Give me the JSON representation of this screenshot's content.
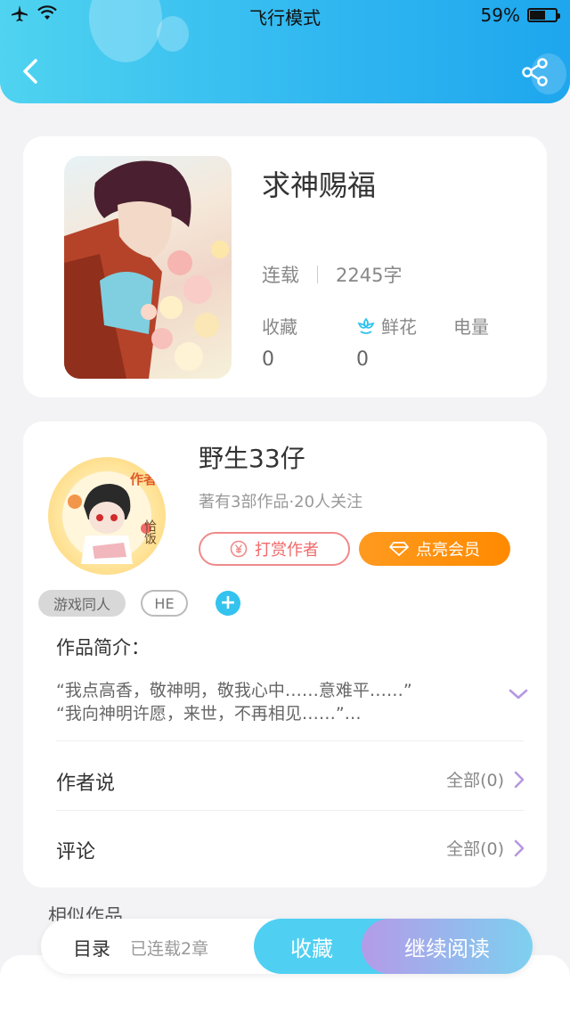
{
  "status_bar": {
    "carrier_mode": "飞行模式",
    "battery_percent": "59%",
    "battery_level": 0.59
  },
  "header": {
    "back_icon": "back-arrow-icon",
    "share_icon": "share-icon"
  },
  "book": {
    "title": "求神赐福",
    "status": "连载",
    "word_count": "2245字",
    "stats": {
      "favorites_label": "收藏",
      "favorites_value": "0",
      "flowers_label": "鲜花",
      "flowers_value": "0",
      "power_label": "电量"
    }
  },
  "author": {
    "name": "野生33仔",
    "subtitle": "著有3部作品·20人关注",
    "tip_label": "打赏作者",
    "vip_label": "点亮会员",
    "avatar_badge_top": "作者",
    "avatar_badge_side": "恰饭"
  },
  "tags": {
    "items": [
      "游戏同人",
      "HE"
    ],
    "add_label": "+"
  },
  "intro": {
    "title": "作品简介：",
    "line1": "“我点高香，敬神明，敬我心中……意难平……”",
    "line2": "“我向神明许愿，来世，不再相见……”…"
  },
  "author_says": {
    "label": "作者说",
    "right": "全部(0)"
  },
  "comments": {
    "label": "评论",
    "right": "全部(0)"
  },
  "similar": {
    "label": "相似作品"
  },
  "bottom_bar": {
    "toc_label": "目录",
    "toc_sub": "已连载2章",
    "favorite_label": "收藏",
    "read_label": "继续阅读"
  },
  "colors": {
    "header_start": "#4fd3f0",
    "header_end": "#1ea6ee",
    "accent_orange": "#ff8a00",
    "tip_red": "#f06a6a",
    "read_purple": "#b49be8"
  }
}
